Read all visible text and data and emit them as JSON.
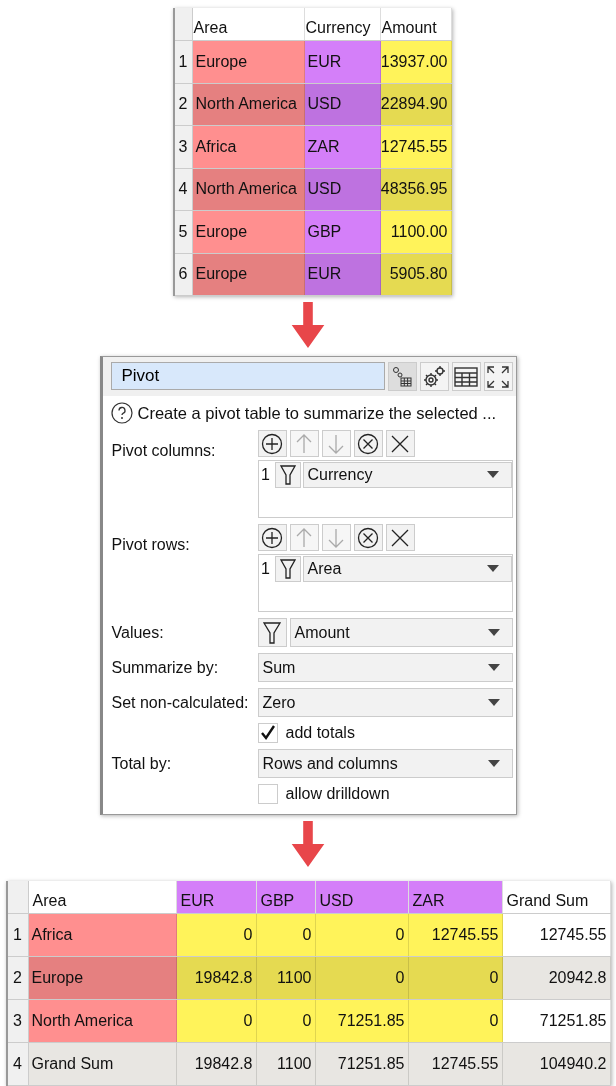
{
  "source_table": {
    "columns": [
      {
        "label": "Area",
        "color": "#ff8f8f"
      },
      {
        "label": "Currency",
        "color": "#d47ff9"
      },
      {
        "label": "Amount",
        "color": "#fff35a",
        "kind": "number"
      }
    ],
    "rows": [
      {
        "num": "1",
        "cells": [
          "Europe",
          "EUR",
          "13937.00"
        ]
      },
      {
        "num": "2",
        "cells": [
          "North America",
          "USD",
          "22894.90"
        ]
      },
      {
        "num": "3",
        "cells": [
          "Africa",
          "ZAR",
          "12745.55"
        ]
      },
      {
        "num": "4",
        "cells": [
          "North America",
          "USD",
          "48356.95"
        ]
      },
      {
        "num": "5",
        "cells": [
          "Europe",
          "GBP",
          "1100.00"
        ]
      },
      {
        "num": "6",
        "cells": [
          "Europe",
          "EUR",
          "5905.80"
        ]
      }
    ]
  },
  "pivot_panel": {
    "title": "Pivot",
    "tool_buttons": [
      {
        "kind": "transform"
      },
      {
        "kind": "settings"
      },
      {
        "kind": "table"
      },
      {
        "kind": "maximize"
      }
    ],
    "help": "Create a pivot table to summarize the selected ...",
    "fields": [
      {
        "kind": "list",
        "label": "Pivot columns:",
        "toolbar": [
          {
            "kind": "add",
            "disabled": false
          },
          {
            "kind": "up",
            "disabled": true
          },
          {
            "kind": "down",
            "disabled": true
          },
          {
            "kind": "remove",
            "disabled": false
          },
          {
            "kind": "clear",
            "disabled": false
          }
        ],
        "items": [
          {
            "num": "1",
            "value": "Currency"
          }
        ]
      },
      {
        "kind": "list",
        "label": "Pivot rows:",
        "toolbar": [
          {
            "kind": "add",
            "disabled": false
          },
          {
            "kind": "up",
            "disabled": true
          },
          {
            "kind": "down",
            "disabled": true
          },
          {
            "kind": "remove",
            "disabled": false
          },
          {
            "kind": "clear",
            "disabled": false
          }
        ],
        "items": [
          {
            "num": "1",
            "value": "Area"
          }
        ]
      },
      {
        "kind": "filter-dropdown",
        "label": "Values:",
        "value": "Amount"
      },
      {
        "kind": "dropdown",
        "label": "Summarize by:",
        "value": "Sum"
      },
      {
        "kind": "dropdown",
        "label": "Set non-calculated:",
        "value": "Zero"
      },
      {
        "kind": "checkbox",
        "label": "add totals",
        "checked": true
      },
      {
        "kind": "dropdown",
        "label": "Total by:",
        "value": "Rows and columns"
      },
      {
        "kind": "checkbox",
        "label": "allow drilldown",
        "checked": false
      }
    ]
  },
  "result_table": {
    "pivot_header": {
      "color": "#d47ff9"
    },
    "columns": [
      {
        "label": "Area",
        "color": "#ff8f8f",
        "kind": "row"
      },
      {
        "label": "EUR",
        "kind": "pivot",
        "color": "#fff35a"
      },
      {
        "label": "GBP",
        "kind": "pivot",
        "color": "#fff35a"
      },
      {
        "label": "USD",
        "kind": "pivot",
        "color": "#fff35a"
      },
      {
        "label": "ZAR",
        "kind": "pivot",
        "color": "#fff35a"
      },
      {
        "label": "Grand Sum",
        "kind": "total"
      }
    ],
    "rows": [
      {
        "num": "1",
        "kind": "data",
        "cells": [
          "Africa",
          "0",
          "0",
          "0",
          "12745.55",
          "12745.55"
        ]
      },
      {
        "num": "2",
        "kind": "data",
        "cells": [
          "Europe",
          "19842.8",
          "1100",
          "0",
          "0",
          "20942.8"
        ]
      },
      {
        "num": "3",
        "kind": "data",
        "cells": [
          "North America",
          "0",
          "0",
          "71251.85",
          "0",
          "71251.85"
        ]
      },
      {
        "num": "4",
        "kind": "total",
        "cells": [
          "Grand Sum",
          "19842.8",
          "1100",
          "71251.85",
          "12745.55",
          "104940.2"
        ]
      }
    ]
  }
}
